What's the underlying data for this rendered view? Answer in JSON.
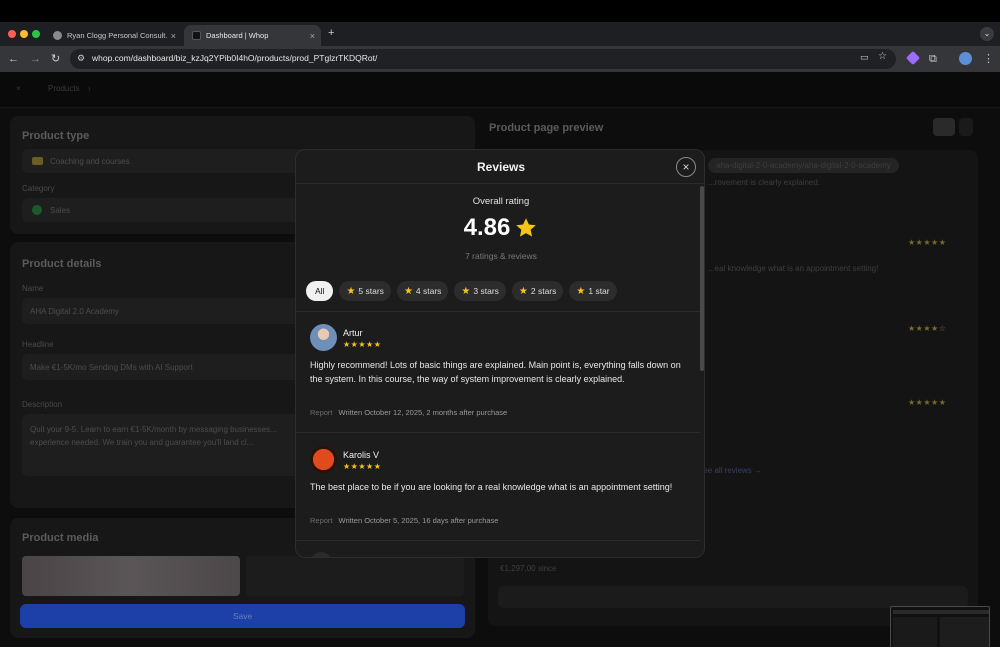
{
  "browser": {
    "tabs": [
      {
        "title": "Ryan Clogg Personal Consult...",
        "close": "×"
      },
      {
        "title": "Dashboard | Whop",
        "close": "×"
      }
    ],
    "new_tab": "+",
    "url": "whop.com/dashboard/biz_kzJq2YPib0I4hO/products/prod_PTglzrTKDQRot/"
  },
  "app": {
    "breadcrumb": [
      "×",
      "Products",
      "›"
    ],
    "product_type": {
      "title": "Product type",
      "value": "Coaching and courses"
    },
    "category": {
      "label": "Category",
      "value": "Sales"
    },
    "product_details": {
      "title": "Product details",
      "name_label": "Name",
      "name_value": "AHA Digital 2.0 Academy",
      "headline_label": "Headline",
      "headline_value": "Make €1-5K/mo Sending DMs with AI Support",
      "description_label": "Description",
      "description_value": "Quit your 9-5. Learn to earn €1-5K/month by messaging businesses... experience needed. We train you and guarantee you'll land cl..."
    },
    "product_media": {
      "title": "Product media"
    },
    "save_label": "Save",
    "preview": {
      "title": "Product page preview",
      "url_fragment": "aha-digital-2-0-academy/aha-digital-2-0-academy",
      "snippet_1": "...rovement is clearly explained.",
      "snippet_2": "...eal knowledge what is an appointment setting!",
      "see_all": "See all reviews →",
      "revenue": "€1,297,00 since"
    }
  },
  "modal": {
    "title": "Reviews",
    "close_label": "×",
    "overall_label": "Overall rating",
    "rating": "4.86",
    "count_text": "7 ratings & reviews",
    "filters": [
      {
        "label": "All",
        "star": false
      },
      {
        "label": "5 stars",
        "star": true
      },
      {
        "label": "4 stars",
        "star": true
      },
      {
        "label": "3 stars",
        "star": true
      },
      {
        "label": "2 stars",
        "star": true
      },
      {
        "label": "1 star",
        "star": true
      }
    ],
    "reviews": [
      {
        "name": "Artur",
        "stars": "★★★★★",
        "text": "Highly recommend! Lots of basic things are explained. Main point is, everything falls down on the system. In this course, the way of system improvement is clearly explained.",
        "report": "Report",
        "meta": "Written October 12, 2025, 2 months after purchase"
      },
      {
        "name": "Karolis V",
        "stars": "★★★★★",
        "text": "The best place to be if you are looking for a real knowledge what is an appointment setting!",
        "report": "Report",
        "meta": "Written October 5, 2025, 16 days after purchase"
      }
    ]
  },
  "colors": {
    "star": "#f5c518",
    "accent": "#1c3fa8"
  }
}
